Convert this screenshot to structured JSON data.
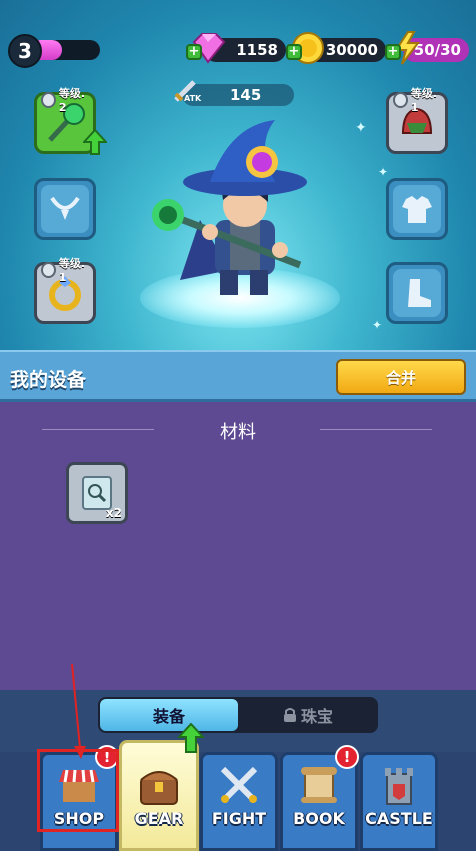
{
  "player": {
    "level": "3",
    "xp_progress": 0.45
  },
  "currencies": [
    {
      "name": "gems",
      "icon": "pink-gem-icon",
      "value": "1158"
    },
    {
      "name": "coins",
      "icon": "gold-coin-icon",
      "value": "30000"
    },
    {
      "name": "energy",
      "icon": "lightning-icon",
      "value": "50/30"
    }
  ],
  "stats": {
    "atk_label": "ATK",
    "atk_value": "145"
  },
  "equipment_slots": {
    "weapon": {
      "level": "等级. 2",
      "icon": "staff-icon"
    },
    "necklace": {
      "icon": "necklace-icon"
    },
    "ring": {
      "level": "等级. 1",
      "icon": "ring-icon"
    },
    "helmet": {
      "level": "等级. 1",
      "icon": "helmet-icon"
    },
    "armor": {
      "icon": "armor-icon"
    },
    "boots": {
      "icon": "boot-icon"
    }
  },
  "my_gear": {
    "title": "我的设备",
    "merge_label": "合并"
  },
  "materials": {
    "title": "材料",
    "items": [
      {
        "icon": "scroll-icon",
        "count": "x2"
      }
    ]
  },
  "tabs": {
    "equipment": "装备",
    "jewelry": "珠宝"
  },
  "nav": [
    {
      "id": "shop",
      "label": "SHOP",
      "icon": "shop-icon",
      "badge": "!"
    },
    {
      "id": "gear",
      "label": "GEAR",
      "icon": "chest-icon"
    },
    {
      "id": "fight",
      "label": "FIGHT",
      "icon": "crossed-swords-icon"
    },
    {
      "id": "book",
      "label": "BOOK",
      "icon": "scroll-book-icon",
      "badge": "!"
    },
    {
      "id": "castle",
      "label": "CASTLE",
      "icon": "castle-icon"
    }
  ],
  "colors": {
    "accent_gold": "#f1a913",
    "nav_blue": "#3a7bc6",
    "panel_purple": "#5e4a92",
    "badge_red": "#e3232f",
    "highlight_red": "#e02323"
  }
}
